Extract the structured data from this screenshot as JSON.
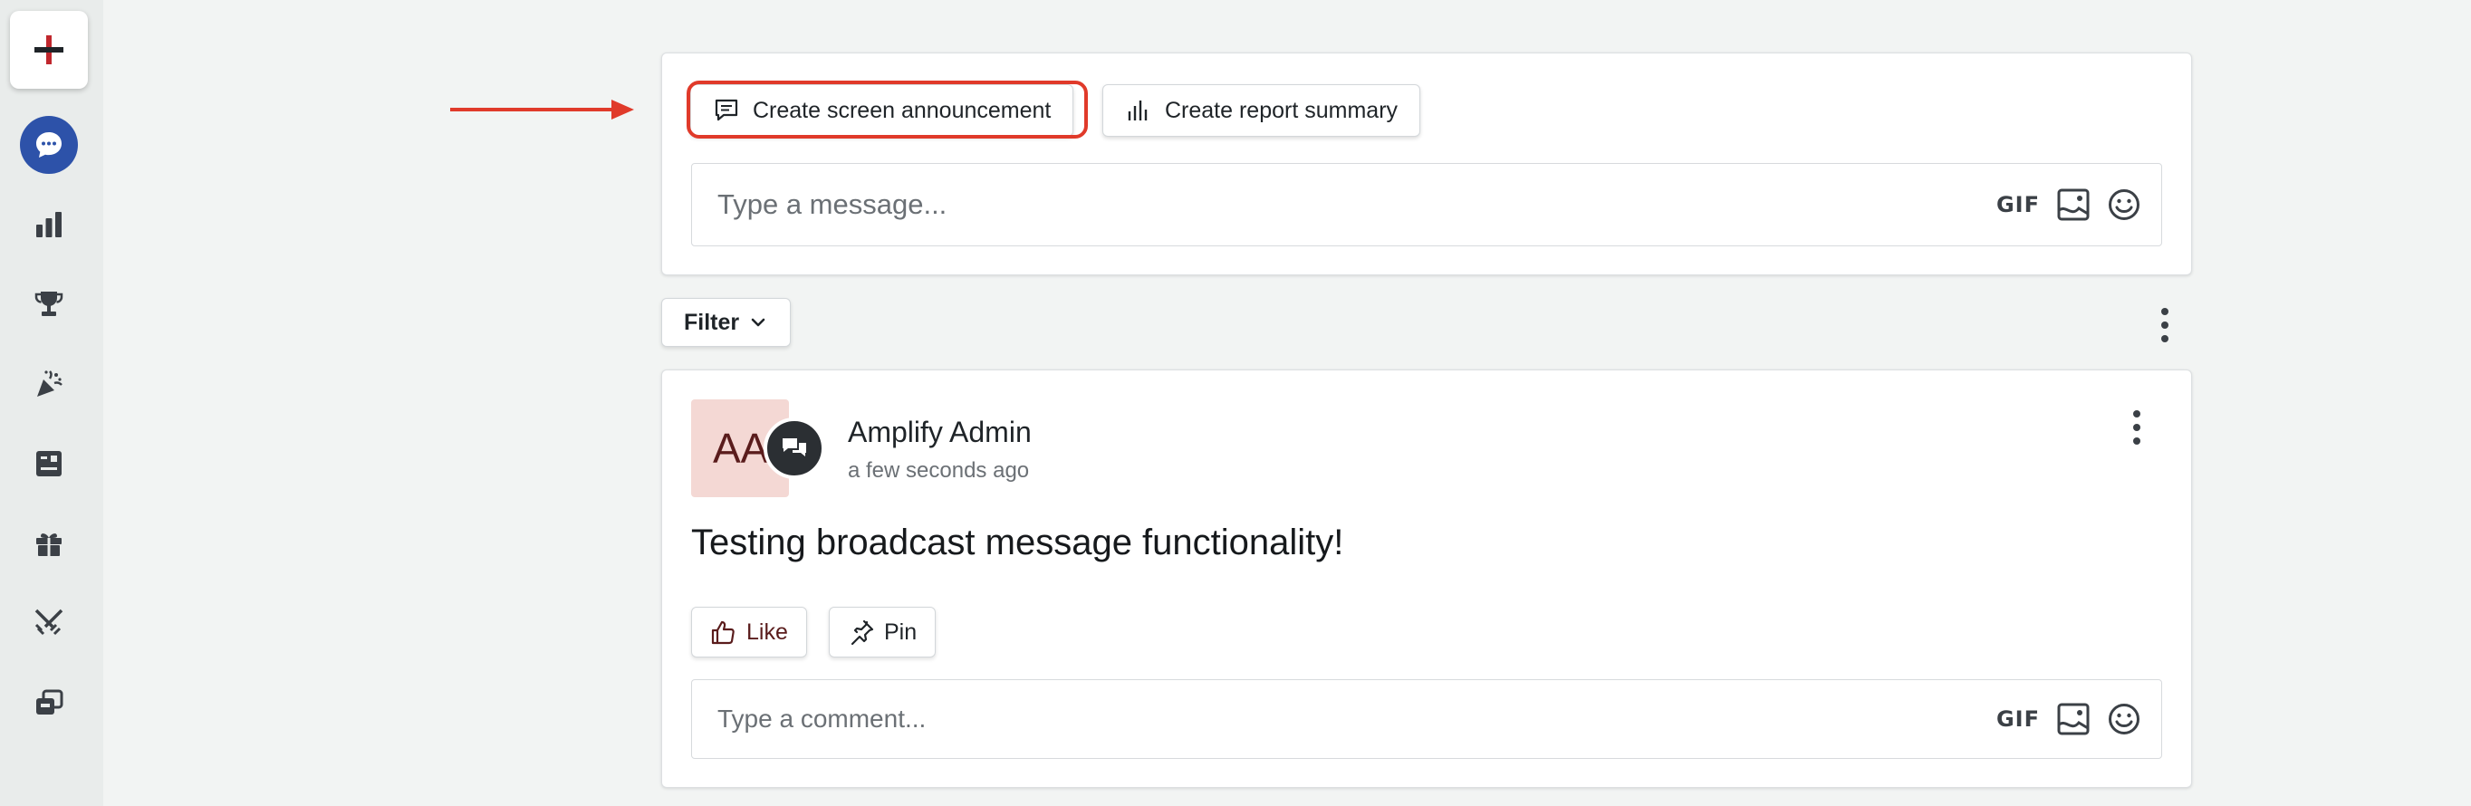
{
  "sidebar": {
    "items": [
      {
        "name": "create",
        "icon": "plus-icon"
      },
      {
        "name": "feed",
        "icon": "chat-bubble-icon"
      },
      {
        "name": "reports",
        "icon": "bar-chart-icon"
      },
      {
        "name": "awards",
        "icon": "trophy-icon"
      },
      {
        "name": "celebrations",
        "icon": "party-popper-icon"
      },
      {
        "name": "scoreboard",
        "icon": "scoreboard-icon"
      },
      {
        "name": "rewards",
        "icon": "gift-icon"
      },
      {
        "name": "competitions",
        "icon": "crossed-swords-icon"
      },
      {
        "name": "integrations",
        "icon": "stacked-windows-icon"
      }
    ],
    "accent_color": "#2d52a9",
    "plus_color": "#c0272d"
  },
  "compose": {
    "announcement_label": "Create screen announcement",
    "report_label": "Create report summary",
    "message_placeholder": "Type a message...",
    "gif_label": "GIF"
  },
  "annotation": {
    "color": "#e03a2a"
  },
  "feed": {
    "filter_label": "Filter"
  },
  "post": {
    "avatar_initials": "AA",
    "author": "Amplify Admin",
    "timestamp": "a few seconds ago",
    "text": "Testing broadcast message functionality!",
    "like_label": "Like",
    "pin_label": "Pin",
    "comment_placeholder": "Type a comment...",
    "gif_label": "GIF"
  }
}
